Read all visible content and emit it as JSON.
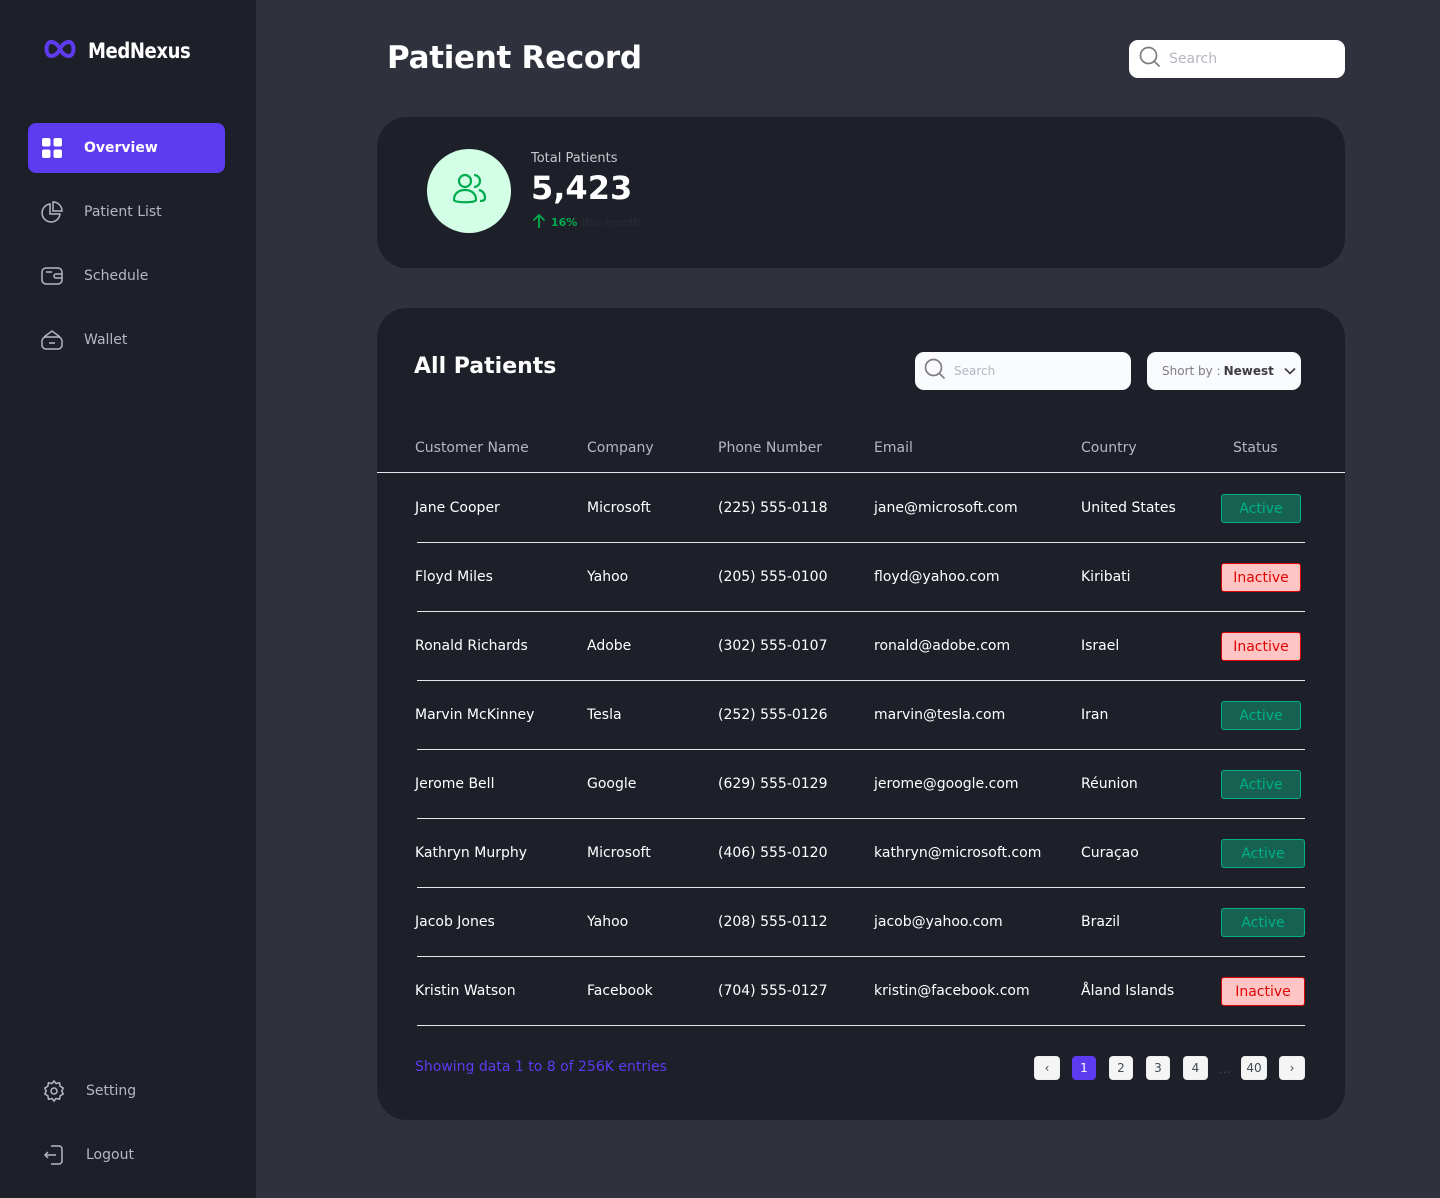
{
  "app": {
    "brand": "MedNexus"
  },
  "sidebar": {
    "items": [
      {
        "label": "Overview",
        "icon": "grid-icon",
        "active": true
      },
      {
        "label": "Patient List",
        "icon": "pie-chart-icon",
        "active": false
      },
      {
        "label": "Schedule",
        "icon": "wallet-card-icon",
        "active": false
      },
      {
        "label": "Wallet",
        "icon": "bag-icon",
        "active": false
      }
    ],
    "bottom": [
      {
        "label": "Setting",
        "icon": "gear-icon"
      },
      {
        "label": "Logout",
        "icon": "logout-icon"
      }
    ]
  },
  "header": {
    "title": "Patient Record",
    "search_placeholder": "Search"
  },
  "stats": {
    "label": "Total Patients",
    "value": "5,423",
    "trend_pct": "16%",
    "trend_text": "this month",
    "trend_color": "#00ac4f"
  },
  "table": {
    "title": "All Patients",
    "search_placeholder": "Search",
    "sort_label": "Short by :",
    "sort_value": "Newest",
    "columns": [
      "Customer Name",
      "Company",
      "Phone Number",
      "Email",
      "Country",
      "Status"
    ],
    "rows": [
      {
        "name": "Jane Cooper",
        "company": "Microsoft",
        "phone": "(225) 555-0118",
        "email": "jane@microsoft.com",
        "country": "United States",
        "status": "Active"
      },
      {
        "name": "Floyd Miles",
        "company": "Yahoo",
        "phone": "(205) 555-0100",
        "email": "floyd@yahoo.com",
        "country": "Kiribati",
        "status": "Inactive"
      },
      {
        "name": "Ronald Richards",
        "company": "Adobe",
        "phone": "(302) 555-0107",
        "email": "ronald@adobe.com",
        "country": "Israel",
        "status": "Inactive"
      },
      {
        "name": "Marvin McKinney",
        "company": "Tesla",
        "phone": "(252) 555-0126",
        "email": "marvin@tesla.com",
        "country": "Iran",
        "status": "Active"
      },
      {
        "name": "Jerome Bell",
        "company": "Google",
        "phone": "(629) 555-0129",
        "email": "jerome@google.com",
        "country": "Réunion",
        "status": "Active"
      },
      {
        "name": "Kathryn Murphy",
        "company": "Microsoft",
        "phone": "(406) 555-0120",
        "email": "kathryn@microsoft.com",
        "country": "Curaçao",
        "status": "Active"
      },
      {
        "name": "Jacob Jones",
        "company": "Yahoo",
        "phone": "(208) 555-0112",
        "email": "jacob@yahoo.com",
        "country": "Brazil",
        "status": "Active"
      },
      {
        "name": "Kristin Watson",
        "company": "Facebook",
        "phone": "(704) 555-0127",
        "email": "kristin@facebook.com",
        "country": "Åland Islands",
        "status": "Inactive"
      }
    ],
    "footer": "Showing data 1 to 8 of  256K entries",
    "pagination": {
      "prev": "‹",
      "pages": [
        "1",
        "2",
        "3",
        "4"
      ],
      "ellipsis": "...",
      "last": "40",
      "next": "›",
      "current": "1"
    }
  },
  "colors": {
    "accent": "#5d3bf0",
    "sidebar_bg": "#1d2029",
    "page_bg": "#2f323d",
    "active_status": "#00b087",
    "inactive_status": "#df0404"
  }
}
